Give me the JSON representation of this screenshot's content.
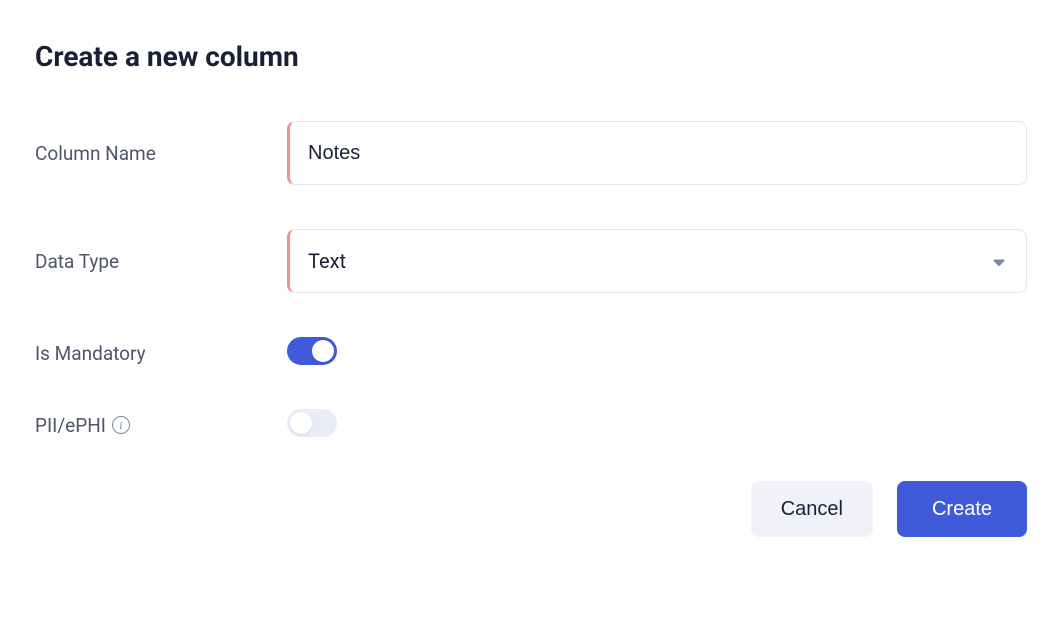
{
  "title": "Create a new column",
  "fields": {
    "column_name": {
      "label": "Column Name",
      "value": "Notes"
    },
    "data_type": {
      "label": "Data Type",
      "value": "Text"
    },
    "is_mandatory": {
      "label": "Is Mandatory",
      "on": true
    },
    "pii_ephi": {
      "label": "PII/ePHI",
      "on": false
    }
  },
  "buttons": {
    "cancel": "Cancel",
    "create": "Create"
  }
}
